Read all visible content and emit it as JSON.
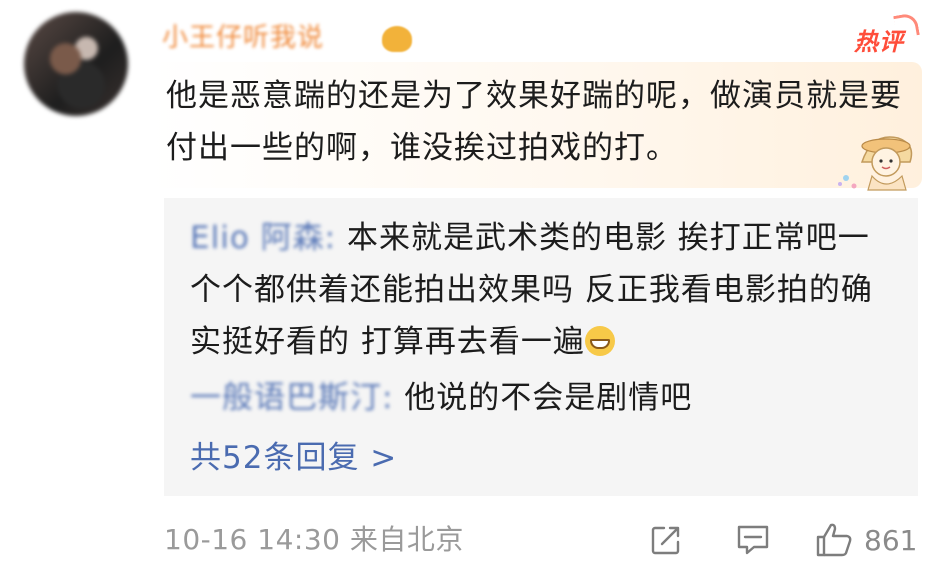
{
  "comment": {
    "username": "小王仔听我说",
    "hot_label": "热评",
    "text": "他是恶意踹的还是为了效果好踹的呢，做演员就是要付出一些的啊，谁没挨过拍戏的打。",
    "timestamp": "10-16 14:30",
    "location": "来自北京",
    "like_count": "861"
  },
  "replies": [
    {
      "user": "Elio 阿森",
      "sep": ":",
      "text": "本来就是武术类的电影 挨打正常吧一个个都供着还能拍出效果吗 反正我看电影拍的确实挺好看的 打算再去看一遍"
    },
    {
      "user": "一般语巴斯汀",
      "sep": ":",
      "text": "他说的不会是剧情吧"
    }
  ],
  "more_replies": "共52条回复 >",
  "icons": {
    "share": "share-icon",
    "comment": "comment-icon",
    "like": "thumbs-up-icon"
  },
  "colors": {
    "username": "#f08a3b",
    "hot": "#ff4d3a",
    "link": "#4a6bb0",
    "meta": "#9a9a9a",
    "reply_bg": "#f5f5f5"
  }
}
